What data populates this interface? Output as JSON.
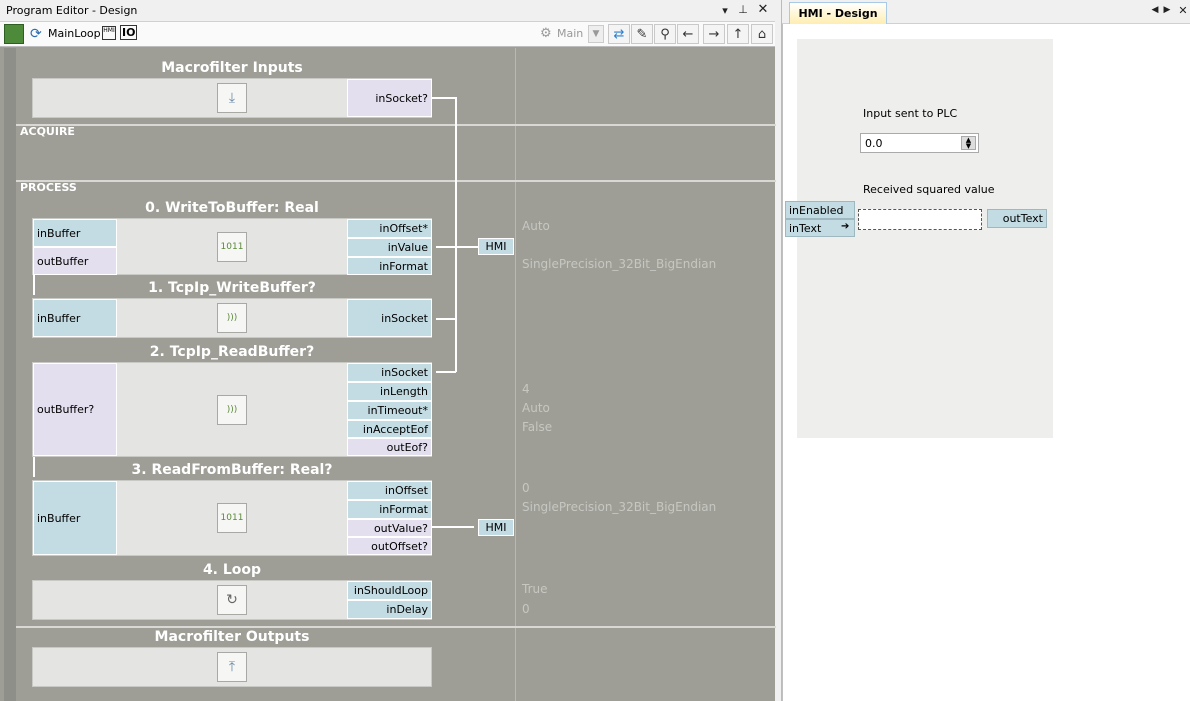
{
  "program_editor": {
    "title": "Program Editor - Design",
    "toolbar": {
      "macro_name": "MainLoop",
      "io_label": "IO",
      "main_label": "Main"
    },
    "sections": {
      "inputs_title": "Macrofilter Inputs",
      "acquire": "ACQUIRE",
      "process": "PROCESS",
      "outputs_title": "Macrofilter Outputs"
    },
    "macro_input_port": "inSocket?",
    "filters": [
      {
        "title": "0. WriteToBuffer: Real",
        "left_ports": [
          "inBuffer",
          "outBuffer"
        ],
        "right_ports": [
          "inOffset*",
          "inValue",
          "inFormat"
        ],
        "values": [
          "Auto",
          "",
          "SinglePrecision_32Bit_BigEndian"
        ]
      },
      {
        "title": "1. TcpIp_WriteBuffer?",
        "left_ports": [
          "inBuffer"
        ],
        "right_ports": [
          "inSocket"
        ]
      },
      {
        "title": "2. TcpIp_ReadBuffer?",
        "left_ports": [
          "outBuffer?"
        ],
        "right_ports": [
          "inSocket",
          "inLength",
          "inTimeout*",
          "inAcceptEof",
          "outEof?"
        ],
        "values": [
          "",
          "4",
          "Auto",
          "False",
          ""
        ]
      },
      {
        "title": "3. ReadFromBuffer: Real?",
        "left_ports": [
          "inBuffer"
        ],
        "right_ports": [
          "inOffset",
          "inFormat",
          "outValue?",
          "outOffset?"
        ],
        "values": [
          "0",
          "SinglePrecision_32Bit_BigEndian",
          "",
          ""
        ]
      },
      {
        "title": "4. Loop",
        "right_ports": [
          "inShouldLoop",
          "inDelay"
        ],
        "values": [
          "True",
          "0"
        ]
      }
    ],
    "hmi_tag": "HMI"
  },
  "hmi_design": {
    "tab_label": "HMI - Design",
    "input_label": "Input sent to PLC",
    "input_value": "0.0",
    "output_label": "Received squared value",
    "output_value": "",
    "ports_in": [
      "inEnabled",
      "inText"
    ],
    "port_out": "outText"
  }
}
